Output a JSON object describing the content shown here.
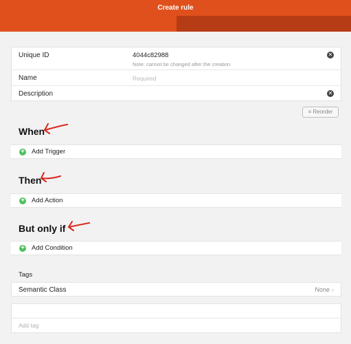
{
  "header": {
    "title": "Create rule"
  },
  "form": {
    "uid": {
      "label": "Unique ID",
      "value": "4044c82988",
      "note": "Note: cannot be changed after the creation"
    },
    "name": {
      "label": "Name",
      "placeholder": "Required"
    },
    "description": {
      "label": "Description",
      "value": ""
    }
  },
  "reorder_label": "Reorder",
  "sections": {
    "when": {
      "title": "When",
      "action": "Add Trigger"
    },
    "then": {
      "title": "Then",
      "action": "Add Action"
    },
    "but_only_if": {
      "title": "But only if",
      "action": "Add Condition"
    }
  },
  "tags": {
    "title": "Tags",
    "semantic_class_label": "Semantic Class",
    "semantic_class_value": "None",
    "add_tag_placeholder": "Add tag"
  },
  "colors": {
    "header": "#e0501c",
    "header_dark": "#b63c16",
    "add_icon": "#4cc15a",
    "annotation": "#d9261c"
  }
}
